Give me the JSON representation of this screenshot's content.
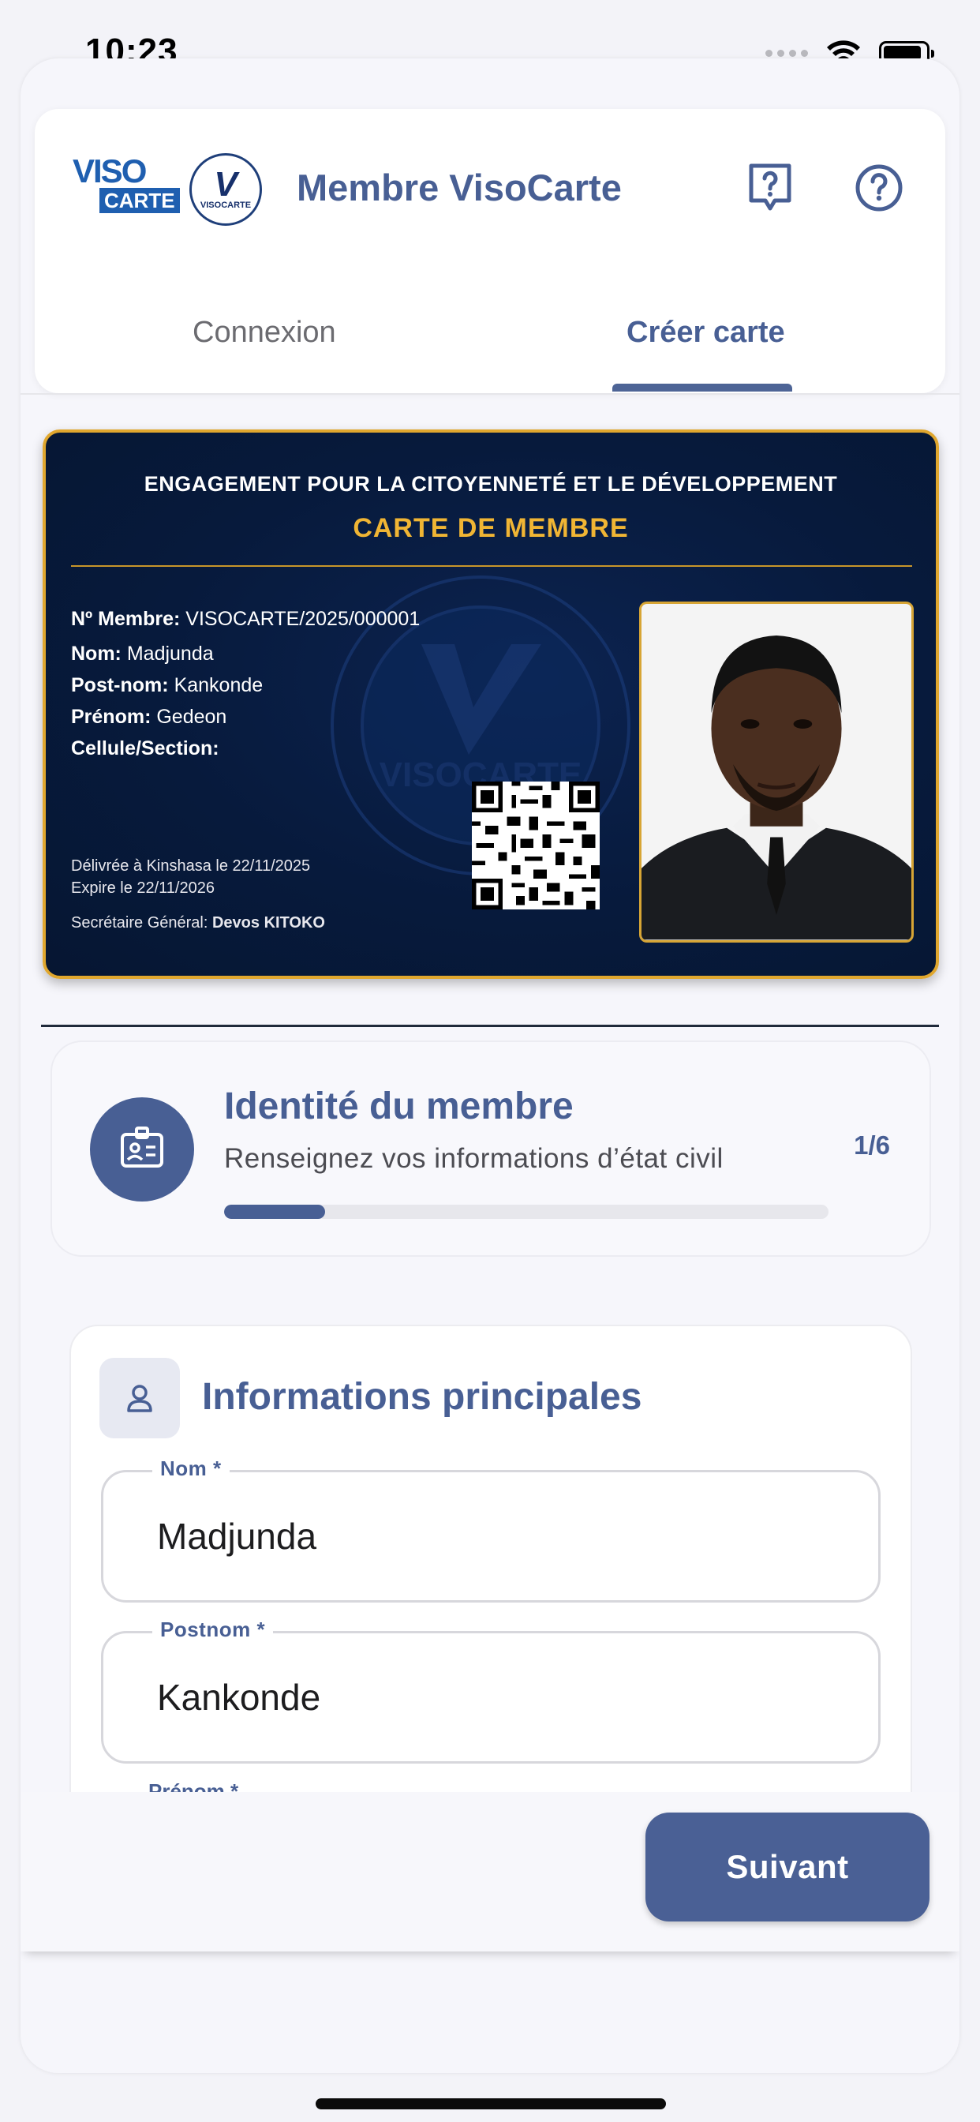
{
  "status_bar": {
    "time": "10:23"
  },
  "header": {
    "logo_text_top": "VISO",
    "logo_text_bottom": "CARTE",
    "circle_logo_letter": "V",
    "circle_logo_text": "VISOCARTE",
    "title": "Membre VisoCarte",
    "icons": [
      "question-bubble-icon",
      "help-circle-icon"
    ]
  },
  "tabs": [
    {
      "label": "Connexion",
      "active": false
    },
    {
      "label": "Créer carte",
      "active": true
    }
  ],
  "member_card": {
    "org": "ENGAGEMENT POUR LA CITOYENNETÉ ET LE DÉVELOPPEMENT",
    "title": "CARTE DE MEMBRE",
    "number_label": "Nº Membre:",
    "number_value": "VISOCARTE/2025/000001",
    "nom_label": "Nom:",
    "nom_value": "Madjunda",
    "postnom_label": "Post-nom:",
    "postnom_value": "Kankonde",
    "prenom_label": "Prénom:",
    "prenom_value": "Gedeon",
    "cellule_label": "Cellule/Section:",
    "cellule_value": "",
    "issued": "Délivrée à Kinshasa le 22/11/2025",
    "expires": "Expire le 22/11/2026",
    "secretary_label": "Secrétaire Général:",
    "secretary_name": "Devos KITOKO",
    "watermark_text": "VISOCARTE",
    "colors": {
      "card_bg": "#071a3c",
      "gold": "#e0a72e",
      "accent": "#485f94"
    }
  },
  "progress": {
    "title": "Identité du membre",
    "subtitle": "Renseignez vos informations d’état civil",
    "step": "1/6",
    "fraction": 0.1667
  },
  "form": {
    "section_title": "Informations principales",
    "fields": [
      {
        "label": "Nom *",
        "value": "Madjunda"
      },
      {
        "label": "Postnom *",
        "value": "Kankonde"
      },
      {
        "label": "Prénom *",
        "value": ""
      }
    ]
  },
  "footer": {
    "next_label": "Suivant"
  }
}
